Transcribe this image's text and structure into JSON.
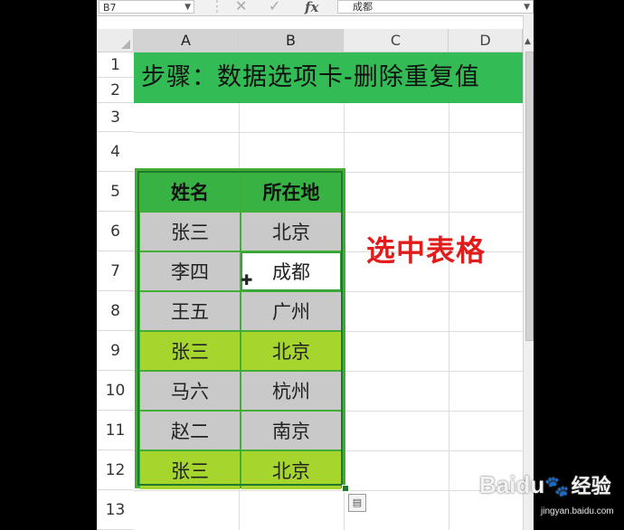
{
  "formula_bar": {
    "name_box": "B7",
    "cancel_icon": "✕",
    "confirm_icon": "✓",
    "fx_label": "fx",
    "content": "成都"
  },
  "columns": [
    "A",
    "B",
    "C",
    "D"
  ],
  "rows": [
    "1",
    "2",
    "3",
    "4",
    "5",
    "6",
    "7",
    "8",
    "9",
    "10",
    "11",
    "12",
    "13"
  ],
  "banner_text": "步骤：数据选项卡-删除重复值",
  "table": {
    "headers": [
      "姓名",
      "所在地"
    ],
    "rows": [
      [
        "张三",
        "北京"
      ],
      [
        "李四",
        "成都"
      ],
      [
        "王五",
        "广州"
      ],
      [
        "张三",
        "北京"
      ],
      [
        "马六",
        "杭州"
      ],
      [
        "赵二",
        "南京"
      ],
      [
        "张三",
        "北京"
      ]
    ]
  },
  "callout": "选中表格",
  "colors": {
    "banner": "#33bb55",
    "header_row": "#39b244",
    "duplicate_highlight": "#a6d62e",
    "normal_row": "#c9c9c9",
    "callout_text": "#e21b1b"
  },
  "watermark": {
    "brand": "Baidu",
    "cn": "经验",
    "url": "jingyan.baidu.com"
  }
}
